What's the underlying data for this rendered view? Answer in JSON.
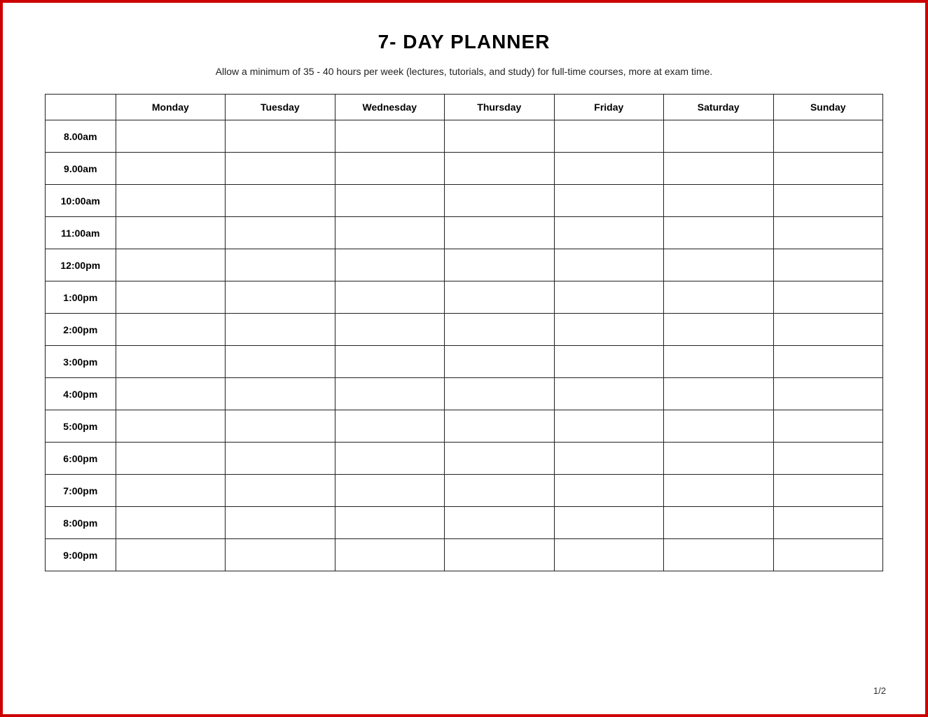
{
  "title": "7- DAY PLANNER",
  "subtitle": "Allow a minimum of 35 - 40 hours per week (lectures, tutorials, and study) for full-time courses, more at exam time.",
  "days": [
    "Monday",
    "Tuesday",
    "Wednesday",
    "Thursday",
    "Friday",
    "Saturday",
    "Sunday"
  ],
  "times": [
    "8.00am",
    "9.00am",
    "10:00am",
    "11:00am",
    "12:00pm",
    "1:00pm",
    "2:00pm",
    "3:00pm",
    "4:00pm",
    "5:00pm",
    "6:00pm",
    "7:00pm",
    "8:00pm",
    "9:00pm"
  ],
  "page_number": "1/2"
}
